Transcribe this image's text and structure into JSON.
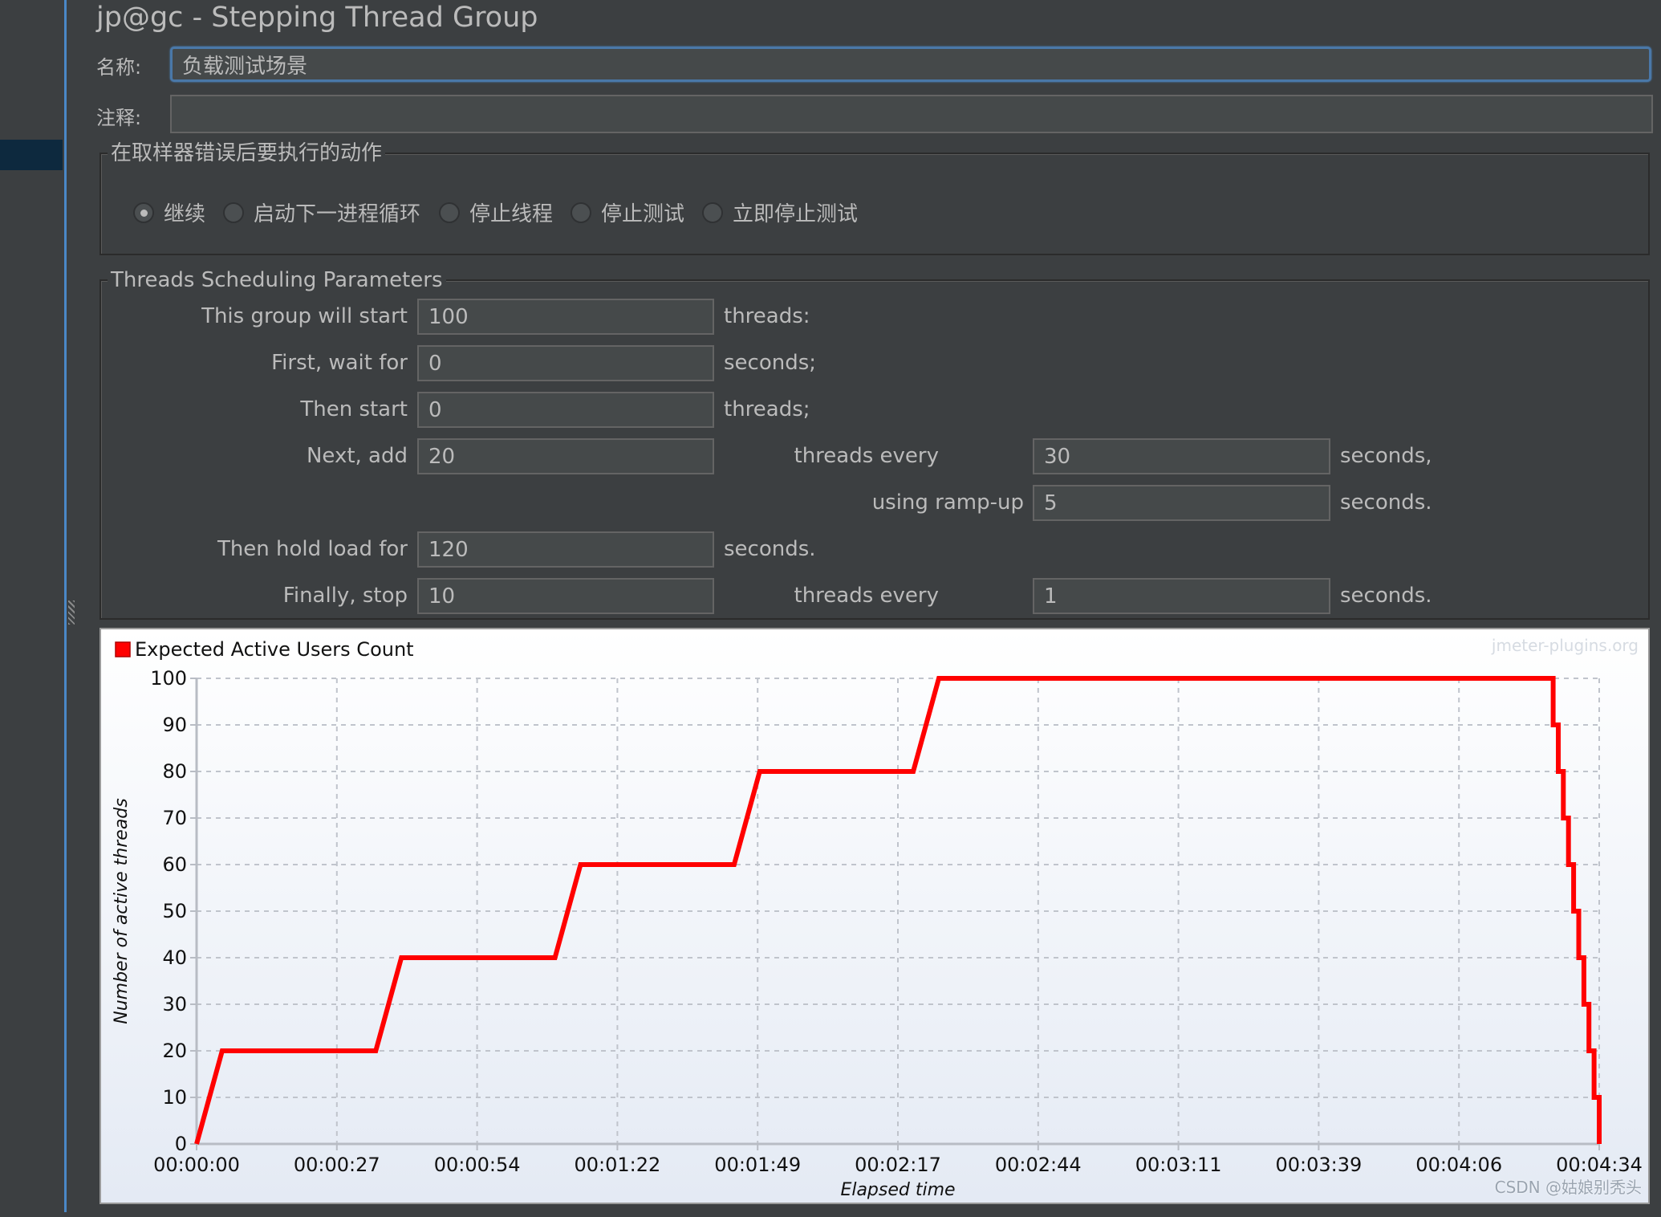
{
  "window": {
    "title": "jp@gc - Stepping Thread Group"
  },
  "form": {
    "name_label": "名称:",
    "name_value": "负载测试场景",
    "comment_label": "注释:",
    "comment_value": ""
  },
  "error_action": {
    "title": "在取样器错误后要执行的动作",
    "options": [
      {
        "label": "继续",
        "selected": true
      },
      {
        "label": "启动下一进程循环",
        "selected": false
      },
      {
        "label": "停止线程",
        "selected": false
      },
      {
        "label": "停止测试",
        "selected": false
      },
      {
        "label": "立即停止测试",
        "selected": false
      }
    ]
  },
  "scheduling": {
    "title": "Threads Scheduling Parameters",
    "rows": [
      {
        "label": "This group will start",
        "value": "100",
        "suffix": "threads:"
      },
      {
        "label": "First, wait for",
        "value": "0",
        "suffix": "seconds;"
      },
      {
        "label": "Then start",
        "value": "0",
        "suffix": "threads;"
      },
      {
        "label": "Next, add",
        "value": "20",
        "mid_label": "threads every",
        "value2": "30",
        "suffix2": "seconds,"
      },
      {
        "mid_label": "using ramp-up",
        "value2": "5",
        "suffix2": "seconds."
      },
      {
        "label": "Then hold load for",
        "value": "120",
        "suffix": "seconds."
      },
      {
        "label": "Finally, stop",
        "value": "10",
        "mid_label": "threads every",
        "value2": "1",
        "suffix2": "seconds."
      }
    ]
  },
  "chart_watermark": "jmeter-plugins.org",
  "csdn_watermark": "CSDN @姑娘别秃头",
  "chart_data": {
    "type": "line",
    "title": "",
    "legend": [
      "Expected Active Users Count"
    ],
    "legend_position": "top-left",
    "series_color": "#ff0000",
    "xlabel": "Elapsed time",
    "ylabel": "Number of active threads",
    "xlim_seconds": [
      0,
      274
    ],
    "ylim": [
      0,
      100
    ],
    "grid": true,
    "x_ticks": [
      "00:00:00",
      "00:00:27",
      "00:00:54",
      "00:01:22",
      "00:01:49",
      "00:02:17",
      "00:02:44",
      "00:03:11",
      "00:03:39",
      "00:04:06",
      "00:04:34"
    ],
    "x_tick_seconds": [
      0,
      27.4,
      54.8,
      82.2,
      109.6,
      137,
      164.4,
      191.8,
      219.2,
      246.6,
      274
    ],
    "y_ticks": [
      0,
      10,
      20,
      30,
      40,
      50,
      60,
      70,
      80,
      90,
      100
    ],
    "series": [
      {
        "name": "Expected Active Users Count",
        "x_seconds": [
          0,
          5,
          35,
          40,
          70,
          75,
          105,
          110,
          140,
          145,
          265,
          265,
          266,
          266,
          267,
          267,
          268,
          268,
          269,
          269,
          270,
          270,
          271,
          271,
          272,
          272,
          273,
          273,
          274,
          274
        ],
        "values": [
          0,
          20,
          20,
          40,
          40,
          60,
          60,
          80,
          80,
          100,
          100,
          90,
          90,
          80,
          80,
          70,
          70,
          60,
          60,
          50,
          50,
          40,
          40,
          30,
          30,
          20,
          20,
          10,
          10,
          0
        ]
      }
    ]
  }
}
